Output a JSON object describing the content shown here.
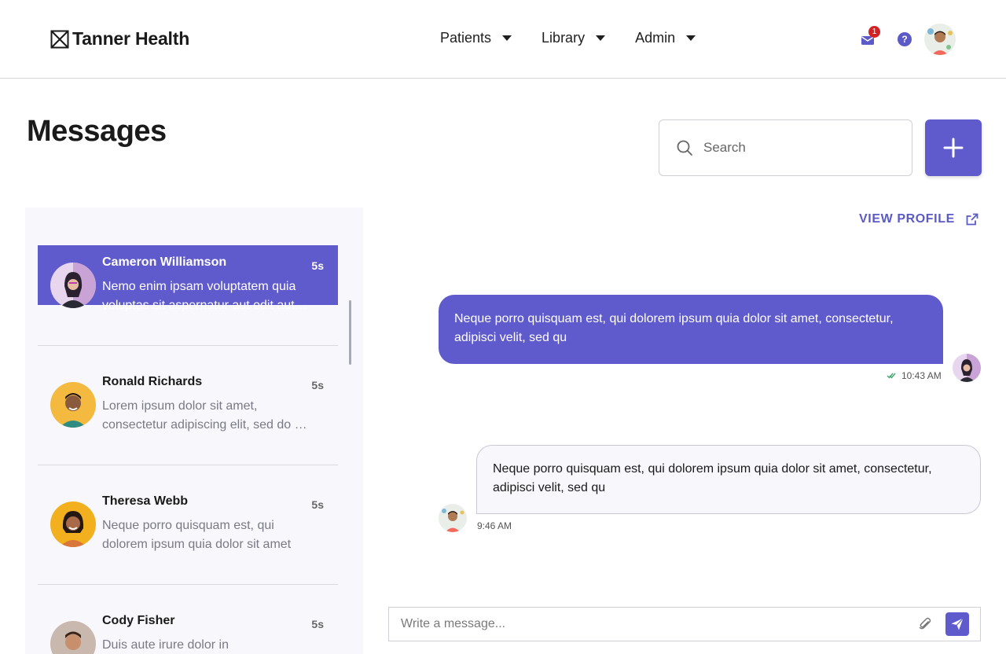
{
  "header": {
    "brand": "Tanner Health",
    "nav": [
      {
        "label": "Patients"
      },
      {
        "label": "Library"
      },
      {
        "label": "Admin"
      }
    ],
    "mail_badge": "1",
    "help_label": "?"
  },
  "page": {
    "title": "Messages",
    "search_placeholder": "Search",
    "add_label": "+"
  },
  "conversations": [
    {
      "name": "Cameron Williamson",
      "time": "5s",
      "preview_line1": "Nemo enim ipsam voluptatem quia",
      "preview_line2": "voluptas sit aspernatur aut odit aut fugit",
      "active": true
    },
    {
      "name": "Ronald Richards",
      "time": "5s",
      "preview_line1": "Lorem ipsum dolor sit amet,",
      "preview_line2": "consectetur adipiscing elit, sed do eiusmod",
      "active": false
    },
    {
      "name": "Theresa Webb",
      "time": "5s",
      "preview_line1": "Neque porro quisquam est, qui",
      "preview_line2": "dolorem ipsum quia dolor sit amet",
      "active": false
    },
    {
      "name": "Cody Fisher",
      "time": "5s",
      "preview_line1": "Duis aute irure dolor in",
      "preview_line2": "",
      "active": false
    }
  ],
  "chat": {
    "view_profile": "VIEW PROFILE",
    "messages": [
      {
        "direction": "outgoing",
        "line1": "Neque porro quisquam est, qui dolorem ipsum quia dolor sit amet, consectetur,",
        "line2": "adipisci velit, sed qu",
        "time": "10:43 AM",
        "status": "read"
      },
      {
        "direction": "incoming",
        "line1": "Neque porro quisquam est, qui dolorem ipsum quia dolor sit amet, consectetur,",
        "line2": "adipisci velit, sed qu",
        "time": "9:46 AM"
      }
    ],
    "composer_placeholder": "Write a message..."
  },
  "icons": {
    "logo": "logo-box-icon",
    "mail": "mail-icon",
    "help": "help-icon",
    "search": "search-icon",
    "add": "plus-icon",
    "external": "external-link-icon",
    "read_check": "double-check-icon",
    "attach": "paperclip-icon",
    "send": "send-icon"
  },
  "colors": {
    "accent": "#5f5bcc",
    "panel_bg": "#f7f7fc",
    "badge": "#d32222"
  }
}
